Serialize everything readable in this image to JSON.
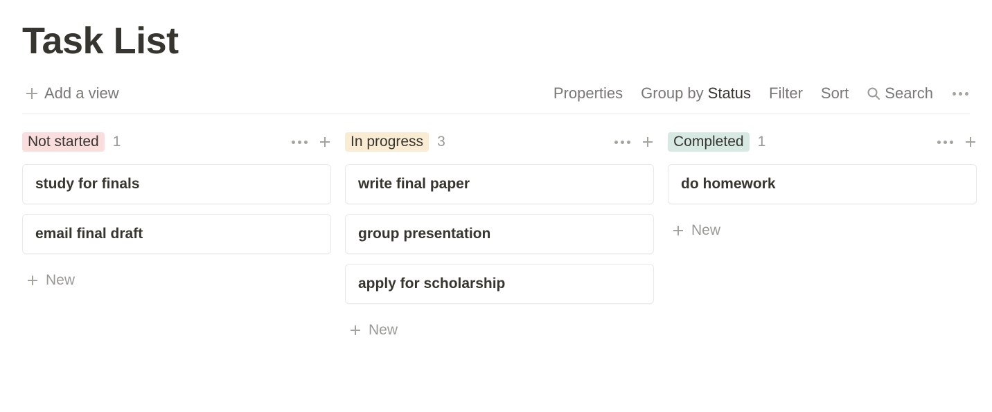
{
  "page": {
    "title": "Task List"
  },
  "toolbar": {
    "add_view": "Add a view",
    "properties": "Properties",
    "group_by_label": "Group by",
    "group_by_value": "Status",
    "filter": "Filter",
    "sort": "Sort",
    "search": "Search"
  },
  "columns": [
    {
      "name": "Not started",
      "count": "1",
      "chip_class": "chip-red",
      "new_label": "New",
      "cards": [
        {
          "title": "study for finals"
        },
        {
          "title": "email final draft"
        }
      ]
    },
    {
      "name": "In progress",
      "count": "3",
      "chip_class": "chip-yellow",
      "new_label": "New",
      "cards": [
        {
          "title": "write final paper"
        },
        {
          "title": "group presentation"
        },
        {
          "title": "apply for scholarship"
        }
      ]
    },
    {
      "name": "Completed",
      "count": "1",
      "chip_class": "chip-green",
      "new_label": "New",
      "cards": [
        {
          "title": "do homework"
        }
      ]
    }
  ]
}
